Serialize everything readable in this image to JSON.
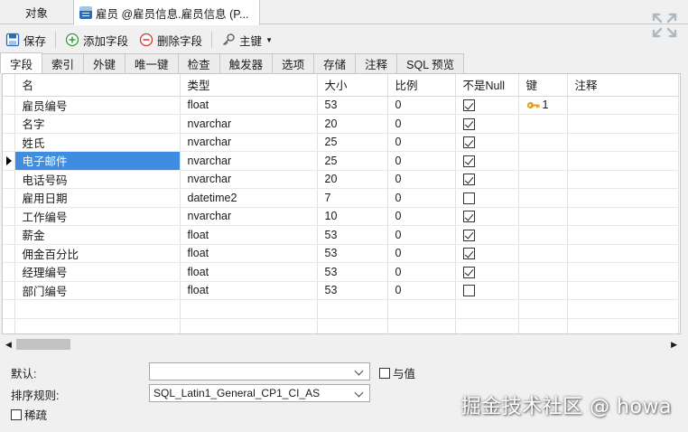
{
  "tabs": [
    {
      "label": "对象"
    },
    {
      "label": "雇员 @雇员信息.雇员信息 (P..."
    }
  ],
  "toolbar": {
    "save_label": "保存",
    "add_field_label": "添加字段",
    "delete_field_label": "删除字段",
    "primary_key_label": "主键"
  },
  "subtabs": [
    "字段",
    "索引",
    "外键",
    "唯一键",
    "检查",
    "触发器",
    "选项",
    "存储",
    "注释",
    "SQL 预览"
  ],
  "grid": {
    "columns": [
      "名",
      "类型",
      "大小",
      "比例",
      "不是Null",
      "键",
      "注释"
    ],
    "rows": [
      {
        "name": "雇员编号",
        "type": "float",
        "size": "53",
        "scale": "0",
        "not_null": true,
        "key": "1",
        "comment": ""
      },
      {
        "name": "名字",
        "type": "nvarchar",
        "size": "20",
        "scale": "0",
        "not_null": true,
        "key": "",
        "comment": ""
      },
      {
        "name": "姓氏",
        "type": "nvarchar",
        "size": "25",
        "scale": "0",
        "not_null": true,
        "key": "",
        "comment": ""
      },
      {
        "name": "电子邮件",
        "type": "nvarchar",
        "size": "25",
        "scale": "0",
        "not_null": true,
        "key": "",
        "comment": ""
      },
      {
        "name": "电话号码",
        "type": "nvarchar",
        "size": "20",
        "scale": "0",
        "not_null": true,
        "key": "",
        "comment": ""
      },
      {
        "name": "雇用日期",
        "type": "datetime2",
        "size": "7",
        "scale": "0",
        "not_null": false,
        "key": "",
        "comment": ""
      },
      {
        "name": "工作编号",
        "type": "nvarchar",
        "size": "10",
        "scale": "0",
        "not_null": true,
        "key": "",
        "comment": ""
      },
      {
        "name": "薪金",
        "type": "float",
        "size": "53",
        "scale": "0",
        "not_null": true,
        "key": "",
        "comment": ""
      },
      {
        "name": "佣金百分比",
        "type": "float",
        "size": "53",
        "scale": "0",
        "not_null": true,
        "key": "",
        "comment": ""
      },
      {
        "name": "经理编号",
        "type": "float",
        "size": "53",
        "scale": "0",
        "not_null": true,
        "key": "",
        "comment": ""
      },
      {
        "name": "部门编号",
        "type": "float",
        "size": "53",
        "scale": "0",
        "not_null": false,
        "key": "",
        "comment": ""
      }
    ],
    "selected_row": 3
  },
  "props": {
    "default_label": "默认:",
    "default_value": "",
    "value_label": "与值",
    "collation_label": "排序规则:",
    "collation_value": "SQL_Latin1_General_CP1_CI_AS",
    "sparse_label": "稀疏"
  },
  "watermark": "掘金技术社区 @ howa",
  "colors": {
    "selection": "#3f8de0",
    "key_icon": "#e0a020"
  }
}
